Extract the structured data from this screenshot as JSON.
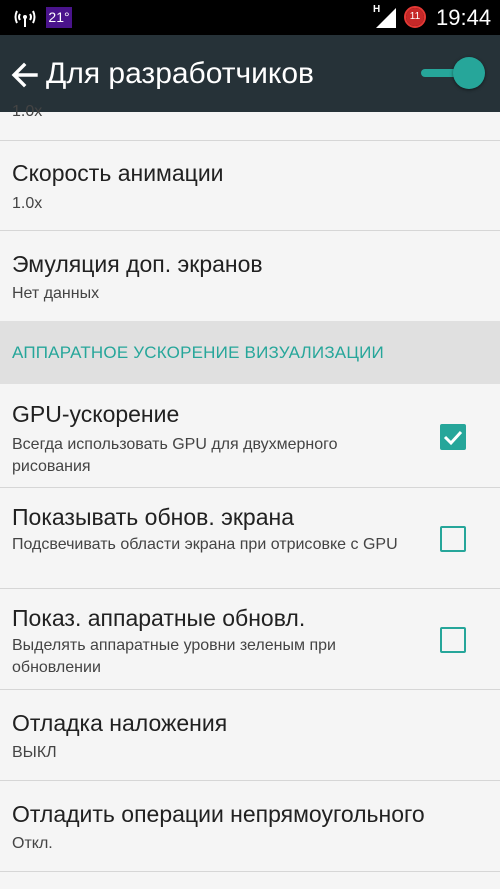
{
  "status_bar": {
    "temperature": "21°",
    "network_type": "H",
    "notification_count": "11",
    "time": "19:44"
  },
  "app_bar": {
    "title": "Для разработчиков",
    "master_switch_on": true
  },
  "cutoff_top": "1.0x",
  "items": [
    {
      "title": "Скорость анимации",
      "summary": "1.0x"
    },
    {
      "title": "Эмуляция доп. экранов",
      "summary": "Нет данных"
    }
  ],
  "section_header": "АППАРАТНОЕ УСКОРЕНИЕ ВИЗУАЛИЗАЦИИ",
  "check_items": [
    {
      "title": "GPU-ускорение",
      "summary": "Всегда использовать GPU для двухмерного рисования",
      "checked": true
    },
    {
      "title": "Показывать обнов. экрана",
      "summary": "Подсвечивать области экрана при отрисовке с GPU",
      "checked": false
    },
    {
      "title": "Показ. аппаратные обновл.",
      "summary": "Выделять аппаратные уровни зеленым при обновлении",
      "checked": false
    }
  ],
  "items2": [
    {
      "title": "Отладка наложения",
      "summary": "ВЫКЛ"
    },
    {
      "title": "Отладить операции непрямоугольного",
      "summary": "Откл."
    }
  ],
  "colors": {
    "accent": "#26a69a",
    "app_bar": "#263238",
    "section_bg": "#e0e0e0"
  }
}
